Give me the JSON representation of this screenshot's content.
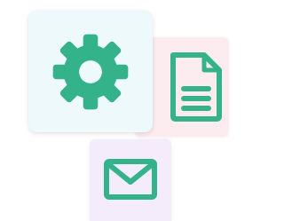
{
  "colors": {
    "icon": "#34b38a",
    "settings_tile_bg": "#eef9fb",
    "document_tile_bg": "#fcecf0",
    "mail_tile_bg": "#f5ecfb"
  },
  "tiles": [
    {
      "id": "settings",
      "icon": "gear-icon"
    },
    {
      "id": "document",
      "icon": "document-icon"
    },
    {
      "id": "mail",
      "icon": "envelope-icon"
    }
  ]
}
